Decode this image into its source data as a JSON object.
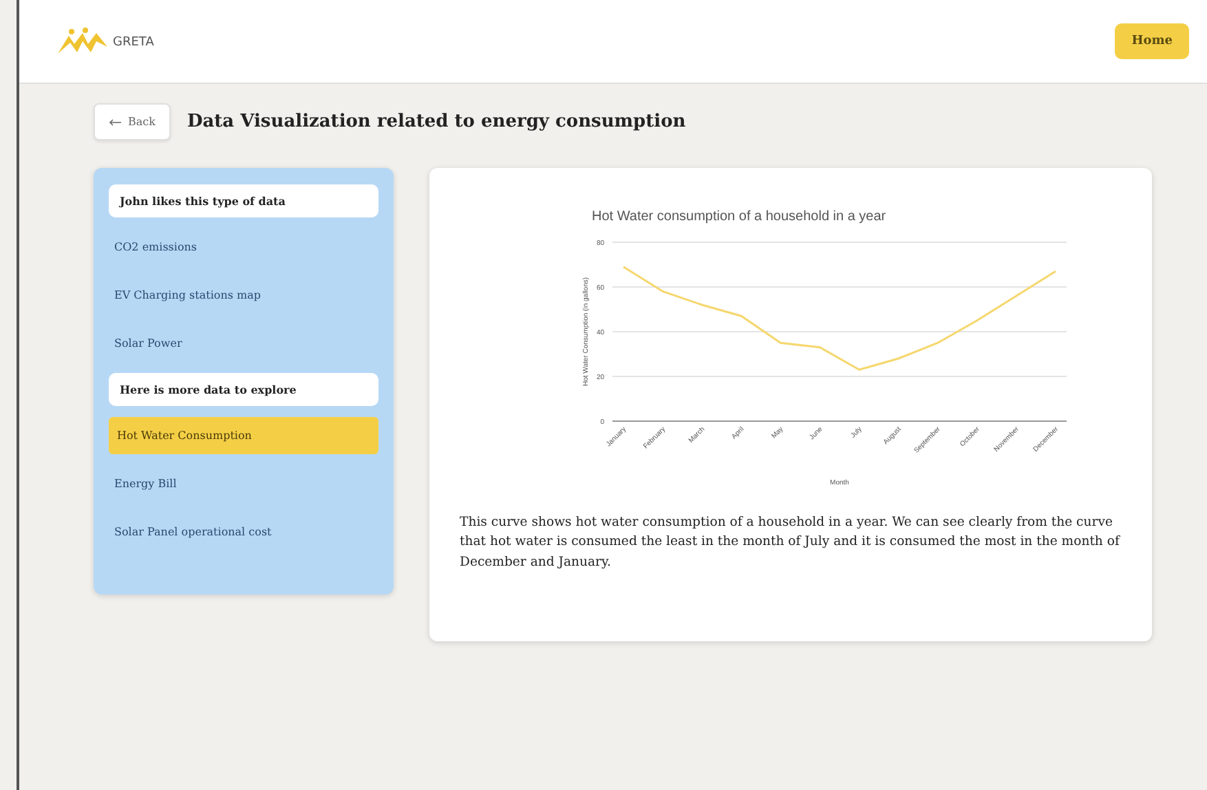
{
  "header": {
    "logo_text": "GRETA",
    "home_button": "Home"
  },
  "page": {
    "back_button": "Back",
    "title": "Data Visualization related to energy consumption"
  },
  "sidebar": {
    "sections": [
      {
        "heading": "John likes this type of data",
        "items": [
          {
            "label": "CO2 emissions",
            "selected": false
          },
          {
            "label": "EV Charging stations map",
            "selected": false
          },
          {
            "label": "Solar Power",
            "selected": false
          }
        ]
      },
      {
        "heading": "Here is more data to explore",
        "items": [
          {
            "label": "Hot Water Consumption",
            "selected": true
          },
          {
            "label": "Energy Bill",
            "selected": false
          },
          {
            "label": "Solar Panel operational cost",
            "selected": false
          }
        ]
      }
    ]
  },
  "chart_data": {
    "type": "line",
    "title": "Hot Water consumption of a household in a year",
    "xlabel": "Month",
    "ylabel": "Hot Water Consumption (in gallons)",
    "categories": [
      "January",
      "February",
      "March",
      "April",
      "May",
      "June",
      "July",
      "August",
      "September",
      "October",
      "November",
      "December"
    ],
    "grid": true,
    "series": [
      {
        "color": "#f5d76e",
        "values": [
          69,
          58,
          52,
          47,
          35,
          33,
          23,
          28,
          35,
          45,
          56,
          67
        ]
      }
    ],
    "ylim": [
      0,
      80
    ],
    "yticks": [
      0,
      20,
      40,
      60,
      80
    ]
  },
  "description": "This curve shows hot water consumption of a household in a year. We can see clearly from the curve that hot water is consumed the least in the month of July and it is consumed the most in the month of December and January."
}
